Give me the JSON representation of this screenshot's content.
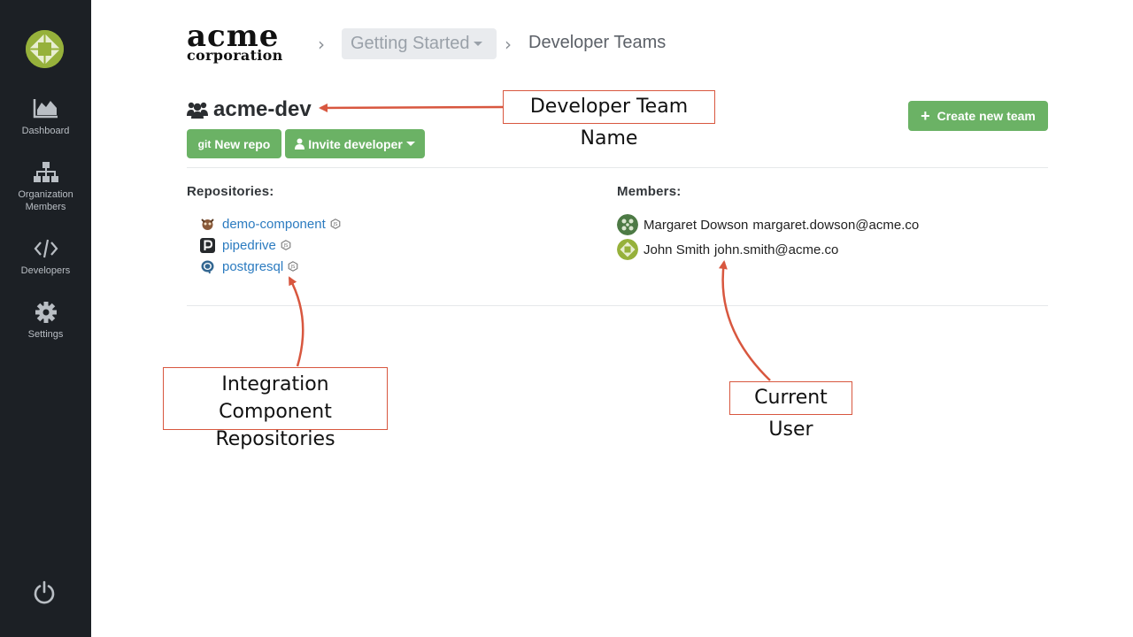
{
  "sidebar": {
    "items": [
      {
        "label": "Dashboard",
        "icon": "chart-area-icon"
      },
      {
        "label": "Organization Members",
        "icon": "sitemap-icon"
      },
      {
        "label": "Developers",
        "icon": "code-icon"
      },
      {
        "label": "Settings",
        "icon": "gear-icon"
      }
    ],
    "logout_icon": "power-icon"
  },
  "header": {
    "brand_top": "acme",
    "brand_bottom": "corporation",
    "breadcrumb_dropdown": "Getting Started",
    "breadcrumb_current": "Developer Teams"
  },
  "team": {
    "name": "acme-dev",
    "new_repo_prefix": "git",
    "new_repo_label": "New repo",
    "invite_label": "Invite developer",
    "create_label": "Create new team"
  },
  "repositories": {
    "heading": "Repositories:",
    "items": [
      {
        "name": "demo-component"
      },
      {
        "name": "pipedrive"
      },
      {
        "name": "postgresql"
      }
    ]
  },
  "members": {
    "heading": "Members:",
    "items": [
      {
        "name": "Margaret Dowson",
        "email": "margaret.dowson@acme.co"
      },
      {
        "name": "John Smith",
        "email": "john.smith@acme.co"
      }
    ]
  },
  "annotations": {
    "team_name": "Developer Team Name",
    "repos_line1": "Integration Component",
    "repos_line2": "Repositories",
    "current_user": "Current User"
  },
  "colors": {
    "sidebar_bg": "#1c2025",
    "accent_green": "#6bb265",
    "link_blue": "#2b7bc0",
    "annotation_red": "#d8573f"
  }
}
